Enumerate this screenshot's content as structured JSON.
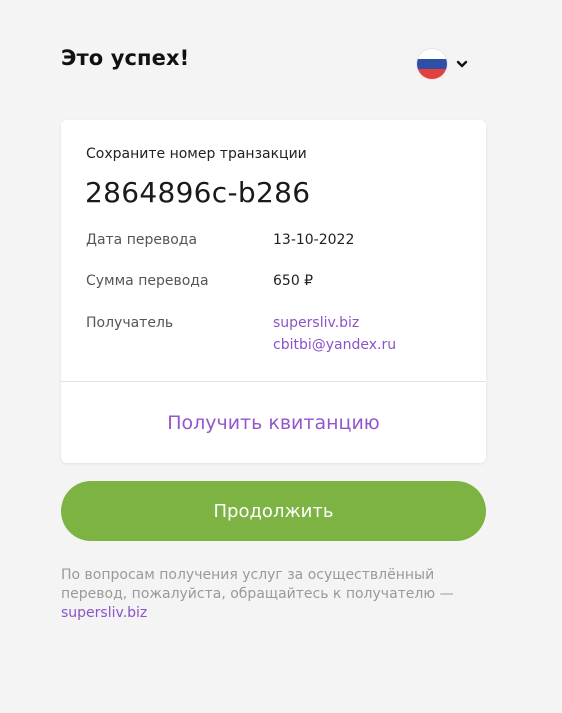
{
  "header": {
    "title": "Это успех!",
    "language_icon": "russia-flag-icon",
    "dropdown_icon": "chevron-down-icon"
  },
  "card": {
    "save_label": "Сохраните номер транзакции",
    "transaction_number": "2864896c-b286",
    "rows": [
      {
        "label": "Дата перевода",
        "value": "13-10-2022"
      },
      {
        "label": "Сумма перевода",
        "value": "650 ₽"
      }
    ],
    "recipient": {
      "label": "Получатель",
      "site": "supersliv.biz",
      "email": "cbitbi@yandex.ru"
    },
    "receipt_link": "Получить квитанцию"
  },
  "continue_button": "Продолжить",
  "footer": {
    "text": "По вопросам получения услуг за осуществлённый перевод, пожалуйста, обращайтесь к получателю —",
    "link": "supersliv.biz"
  },
  "colors": {
    "accent_purple": "#8a53c9",
    "button_green": "#7cb342",
    "background": "#f4f4f4"
  }
}
